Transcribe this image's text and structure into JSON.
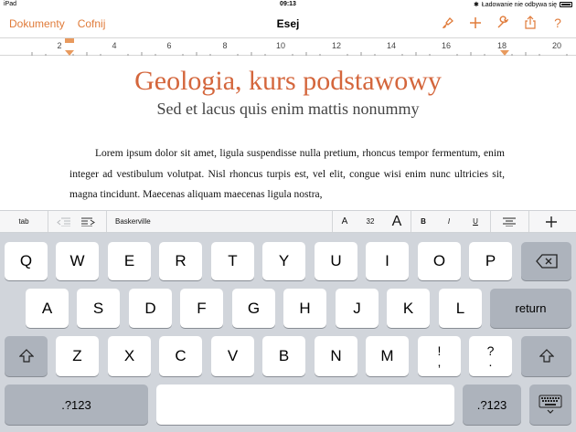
{
  "status": {
    "device": "iPad",
    "time": "09:13",
    "charging": "Ładowanie nie odbywa się"
  },
  "nav": {
    "back": "Dokumenty",
    "undo": "Cofnij",
    "title": "Esej"
  },
  "ruler": {
    "numbers": [
      "2",
      "4",
      "6",
      "8",
      "10",
      "12",
      "14",
      "16",
      "18",
      "20"
    ]
  },
  "document": {
    "title": "Geologia, kurs podstawowy",
    "subtitle": "Sed et lacus quis enim mattis nonummy",
    "body": "Lorem ipsum dolor sit amet, ligula suspendisse nulla pretium, rhoncus tempor fermentum, enim integer ad vestibulum volutpat. Nisl rhoncus turpis est, vel elit, congue wisi enim nunc ultricies sit, magna tincidunt. Maecenas aliquam maecenas ligula nostra,"
  },
  "format_bar": {
    "tab": "tab",
    "font": "Baskerville",
    "small_a": "A",
    "size": "32",
    "large_a": "A",
    "bold": "B",
    "italic": "I",
    "underline": "U"
  },
  "keyboard": {
    "row1": [
      "Q",
      "W",
      "E",
      "R",
      "T",
      "Y",
      "U",
      "I",
      "O",
      "P"
    ],
    "row2": [
      "A",
      "S",
      "D",
      "F",
      "G",
      "H",
      "J",
      "K",
      "L"
    ],
    "row3": [
      "Z",
      "X",
      "C",
      "V",
      "B",
      "N",
      "M"
    ],
    "punct1": {
      "top": "!",
      "bottom": ","
    },
    "punct2": {
      "top": "?",
      "bottom": "."
    },
    "return": "return",
    "numbers": ".?123"
  },
  "colors": {
    "accent": "#e07b3a",
    "title": "#d4663c",
    "keyboard_bg": "#d1d5db"
  }
}
